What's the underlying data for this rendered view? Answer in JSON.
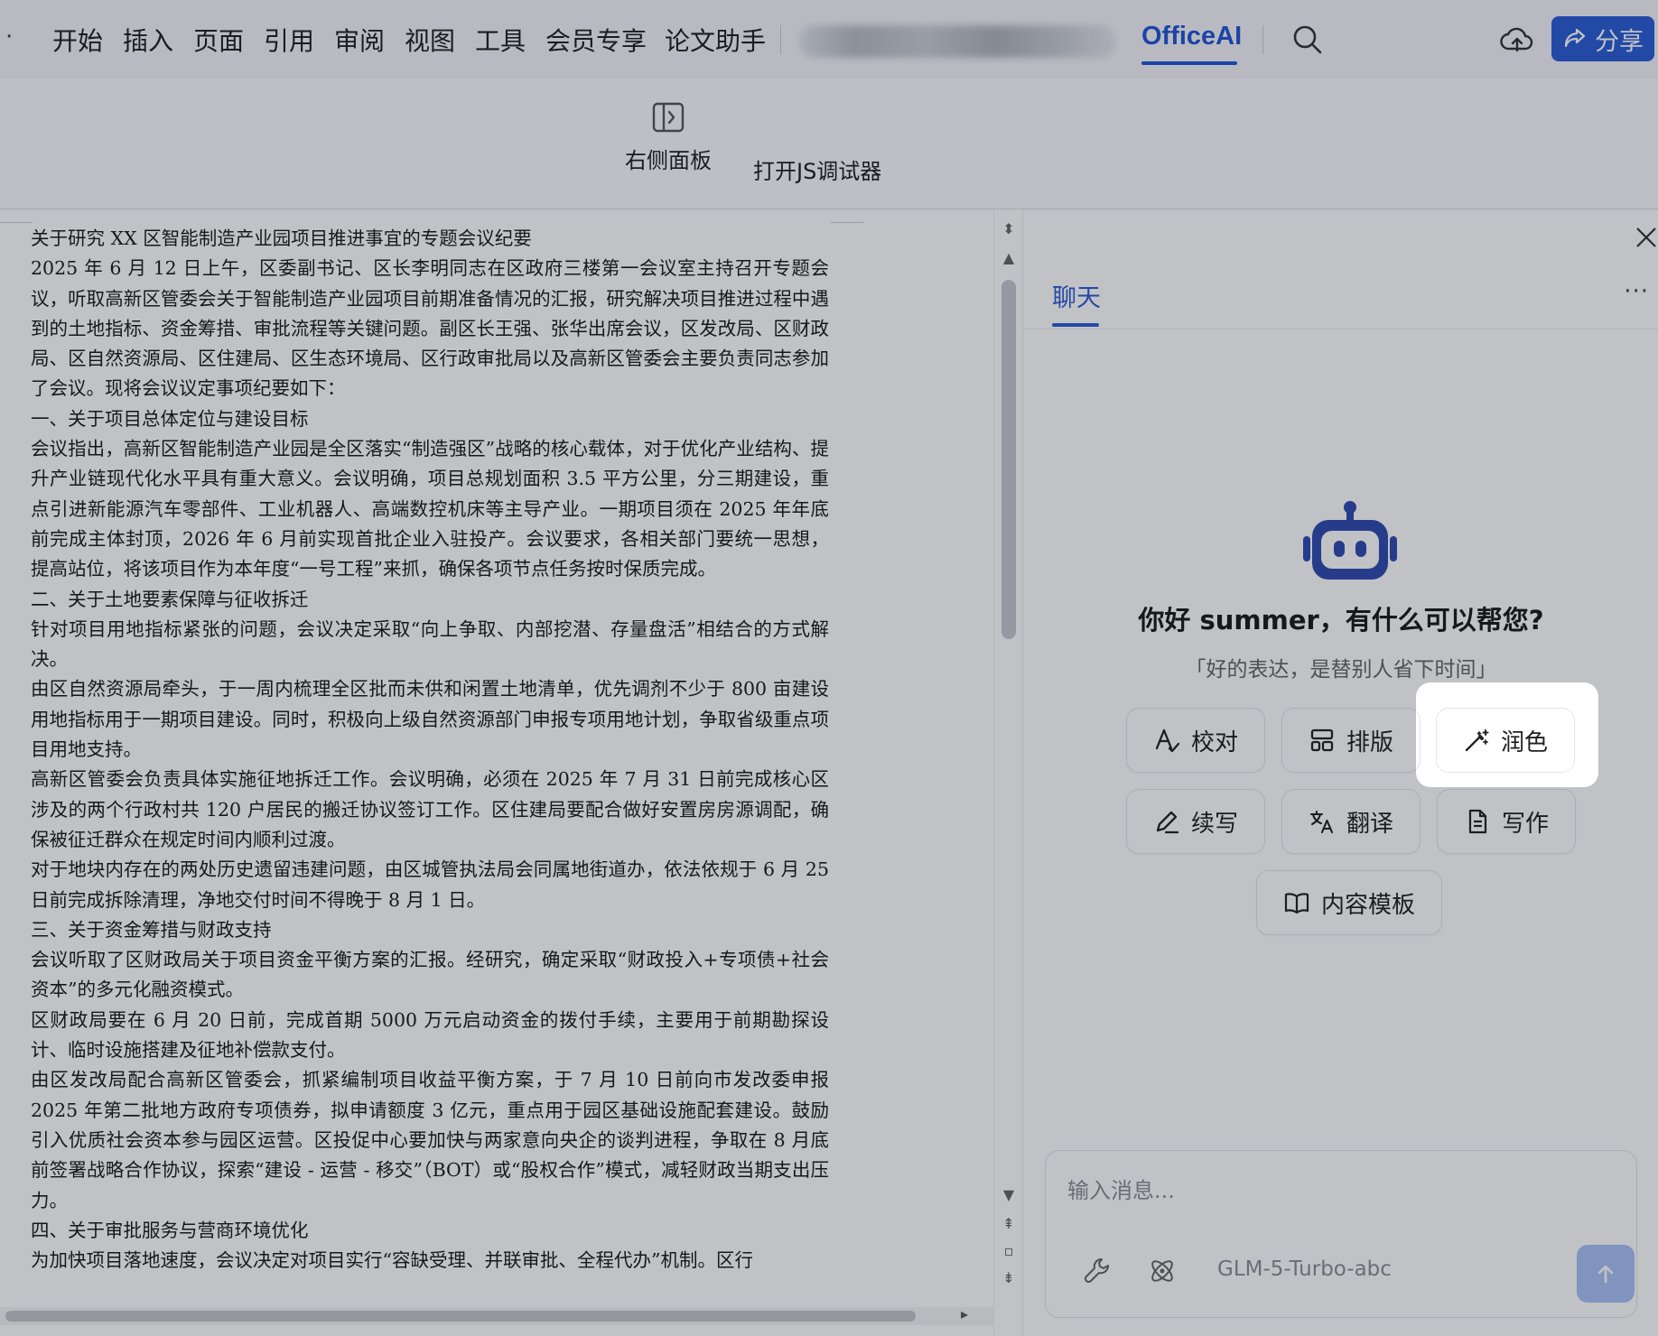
{
  "menubar": {
    "items": [
      "开始",
      "插入",
      "页面",
      "引用",
      "审阅",
      "视图",
      "工具",
      "会员专享",
      "论文助手"
    ],
    "active_tab": "OfficeAI",
    "share_label": "分享"
  },
  "ribbon": {
    "right_panel_label": "右侧面板",
    "js_debugger_label": "打开JS调试器"
  },
  "document": {
    "paragraphs": [
      "关于研究 XX 区智能制造产业园项目推进事宜的专题会议纪要",
      "2025 年 6 月 12 日上午，区委副书记、区长李明同志在区政府三楼第一会议室主持召开专题会议，听取高新区管委会关于智能制造产业园项目前期准备情况的汇报，研究解决项目推进过程中遇到的土地指标、资金筹措、审批流程等关键问题。副区长王强、张华出席会议，区发改局、区财政局、区自然资源局、区住建局、区生态环境局、区行政审批局以及高新区管委会主要负责同志参加了会议。现将会议议定事项纪要如下：",
      "一、关于项目总体定位与建设目标",
      "会议指出，高新区智能制造产业园是全区落实“制造强区”战略的核心载体，对于优化产业结构、提升产业链现代化水平具有重大意义。会议明确，项目总规划面积 3.5 平方公里，分三期建设，重点引进新能源汽车零部件、工业机器人、高端数控机床等主导产业。一期项目须在 2025 年年底前完成主体封顶，2026 年 6 月前实现首批企业入驻投产。会议要求，各相关部门要统一思想，提高站位，将该项目作为本年度“一号工程”来抓，确保各项节点任务按时保质完成。",
      "二、关于土地要素保障与征收拆迁",
      "针对项目用地指标紧张的问题，会议决定采取“向上争取、内部挖潜、存量盘活”相结合的方式解决。",
      "由区自然资源局牵头，于一周内梳理全区批而未供和闲置土地清单，优先调剂不少于 800 亩建设用地指标用于一期项目建设。同时，积极向上级自然资源部门申报专项用地计划，争取省级重点项目用地支持。",
      "高新区管委会负责具体实施征地拆迁工作。会议明确，必须在 2025 年 7 月 31 日前完成核心区涉及的两个行政村共 120 户居民的搬迁协议签订工作。区住建局要配合做好安置房房源调配，确保被征迁群众在规定时间内顺利过渡。",
      "对于地块内存在的两处历史遗留违建问题，由区城管执法局会同属地街道办，依法依规于 6 月 25 日前完成拆除清理，净地交付时间不得晚于 8 月 1 日。",
      "三、关于资金筹措与财政支持",
      "会议听取了区财政局关于项目资金平衡方案的汇报。经研究，确定采取“财政投入+专项债+社会资本”的多元化融资模式。",
      "区财政局要在 6 月 20 日前，完成首期 5000 万元启动资金的拨付手续，主要用于前期勘探设计、临时设施搭建及征地补偿款支付。",
      "由区发改局配合高新区管委会，抓紧编制项目收益平衡方案，于 7 月 10 日前向市发改委申报 2025 年第二批地方政府专项债券，拟申请额度 3 亿元，重点用于园区基础设施配套建设。鼓励引入优质社会资本参与园区运营。区投促中心要加快与两家意向央企的谈判进程，争取在 8 月底前签署战略合作协议，探索“建设 - 运营 - 移交”（BOT）或“股权合作”模式，减轻财政当期支出压力。",
      "四、关于审批服务与营商环境优化",
      "为加快项目落地速度，会议决定对项目实行“容缺受理、并联审批、全程代办”机制。区行"
    ]
  },
  "panel": {
    "tab_chat": "聊天",
    "more": "···",
    "greeting": "你好 summer，有什么可以帮您?",
    "subtitle": "「好的表达，是替别人省下时间」",
    "features": {
      "proofread": "校对",
      "layout": "排版",
      "polish": "润色",
      "continue": "续写",
      "translate": "翻译",
      "write": "写作",
      "template": "内容模板"
    },
    "input_placeholder": "输入消息...",
    "model_name": "GLM-5-Turbo-abc"
  },
  "colors": {
    "accent": "#2a5cd6",
    "send_button": "#a9c1f5",
    "overlay": "rgba(15,20,35,0.26)"
  }
}
